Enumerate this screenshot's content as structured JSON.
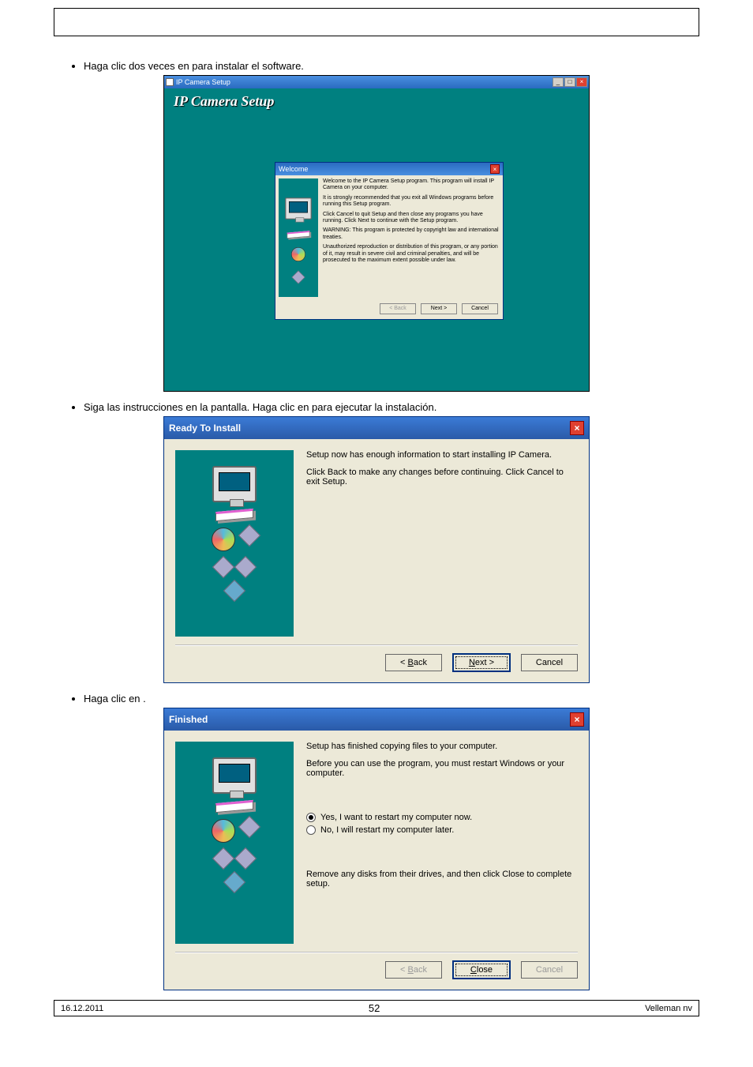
{
  "doc": {
    "bullet1": "Haga clic dos veces en             para instalar el software.",
    "bullet2": "Siga las instrucciones en la pantalla. Haga clic en         para ejecutar la instalación.",
    "bullet3": "Haga clic en        ."
  },
  "shot1": {
    "titlebar": "IP Camera Setup",
    "banner": "IP Camera Setup",
    "welcome_title": "Welcome",
    "p1": "Welcome to the IP Camera Setup program. This program will install IP Camera on your computer.",
    "p2": "It is strongly recommended that you exit all Windows programs before running this Setup program.",
    "p3": "Click Cancel to quit Setup and then close any programs you have running. Click Next to continue with the Setup program.",
    "p4": "WARNING: This program is protected by copyright law and international treaties.",
    "p5": "Unauthorized reproduction or distribution of this program, or any portion of it, may result in severe civil and criminal penalties, and will be prosecuted to the maximum extent possible under law.",
    "back": "< Back",
    "next": "Next >",
    "cancel": "Cancel"
  },
  "shot2": {
    "title": "Ready To Install",
    "p1": "Setup now has enough information to start installing IP Camera.",
    "p2": "Click Back to make any changes before continuing. Click Cancel to exit Setup.",
    "back": "< Back",
    "next": "Next >",
    "cancel": "Cancel"
  },
  "shot3": {
    "title": "Finished",
    "p1": "Setup has finished copying files to your computer.",
    "p2": "Before you can use the program, you must restart Windows or your computer.",
    "radio1": "Yes, I want to restart my computer now.",
    "radio2": "No, I will restart my computer later.",
    "p3": "Remove any disks from their drives, and then click Close to complete setup.",
    "back": "< Back",
    "close": "Close",
    "cancel": "Cancel"
  },
  "footer": {
    "date": "16.12.2011",
    "page": "52",
    "company": "Velleman nv"
  }
}
